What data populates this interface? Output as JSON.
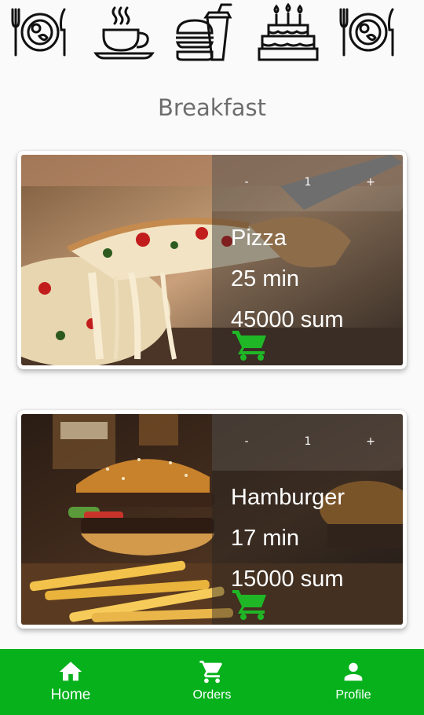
{
  "categories": [
    {
      "icon": "plate-cutlery-icon"
    },
    {
      "icon": "coffee-cup-icon"
    },
    {
      "icon": "burger-drink-icon"
    },
    {
      "icon": "birthday-cake-icon"
    },
    {
      "icon": "plate-cutlery-icon"
    }
  ],
  "section": {
    "title": "Breakfast"
  },
  "items": [
    {
      "name": "Pizza",
      "time": "25 min",
      "price": "45000 sum",
      "qty": "1",
      "minus_label": "-",
      "plus_label": "+",
      "cart_icon": "cart-icon",
      "photo": "pizza-photo"
    },
    {
      "name": "Hamburger",
      "time": "17 min",
      "price": "15000 sum",
      "qty": "1",
      "minus_label": "-",
      "plus_label": "+",
      "cart_icon": "cart-icon",
      "photo": "hamburger-photo"
    }
  ],
  "nav": {
    "home": {
      "label": "Home",
      "icon": "home-icon"
    },
    "orders": {
      "label": "Orders",
      "icon": "cart-icon"
    },
    "profile": {
      "label": "Profile",
      "icon": "person-icon"
    }
  },
  "colors": {
    "nav_bg": "#06b11c",
    "cart_green": "#1fb726",
    "title_gray": "#6d6d6d",
    "background": "#fafafa"
  }
}
